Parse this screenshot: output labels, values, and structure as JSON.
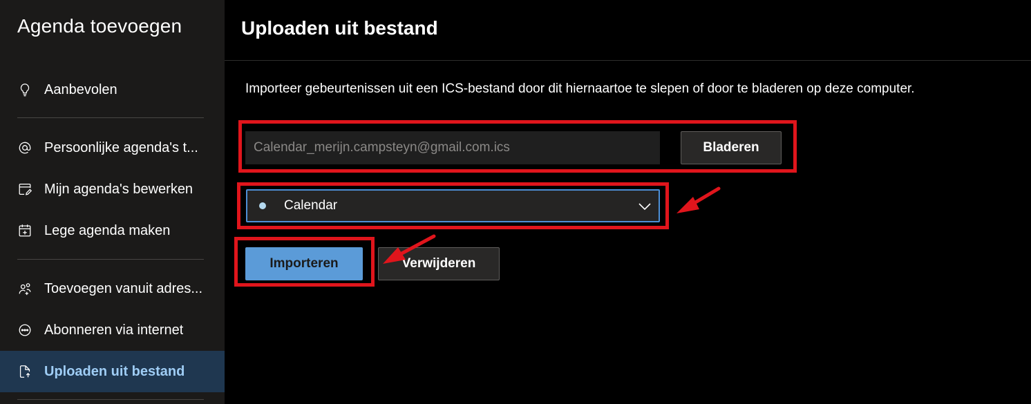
{
  "sidebar": {
    "title": "Agenda toevoegen",
    "items": [
      {
        "label": "Aanbevolen",
        "icon": "lightbulb-icon"
      },
      {
        "label": "Persoonlijke agenda's t...",
        "icon": "at-icon"
      },
      {
        "label": "Mijn agenda's bewerken",
        "icon": "edit-calendar-icon"
      },
      {
        "label": "Lege agenda maken",
        "icon": "calendar-add-icon"
      },
      {
        "label": "Toevoegen vanuit adres...",
        "icon": "people-add-icon"
      },
      {
        "label": "Abonneren via internet",
        "icon": "link-circle-icon"
      },
      {
        "label": "Uploaden uit bestand",
        "icon": "document-upload-icon",
        "active": true
      }
    ]
  },
  "main": {
    "title": "Uploaden uit bestand",
    "description": "Importeer gebeurtenissen uit een ICS-bestand door dit hiernaartoe te slepen of door te bladeren op deze computer.",
    "file_field": {
      "value": "Calendar_merijn.campsteyn@gmail.com.ics"
    },
    "browse_label": "Bladeren",
    "calendar_select": {
      "selected": "Calendar",
      "dot_color": "#b4d8ee"
    },
    "import_label": "Importeren",
    "remove_label": "Verwijderen"
  },
  "colors": {
    "sidebar_bg": "#1b1a19",
    "active_bg": "#1f3750",
    "active_text": "#9fcdf5",
    "primary_button": "#5b9bd8",
    "annotation_red": "#e0151c",
    "select_border": "#4d8fd6"
  }
}
